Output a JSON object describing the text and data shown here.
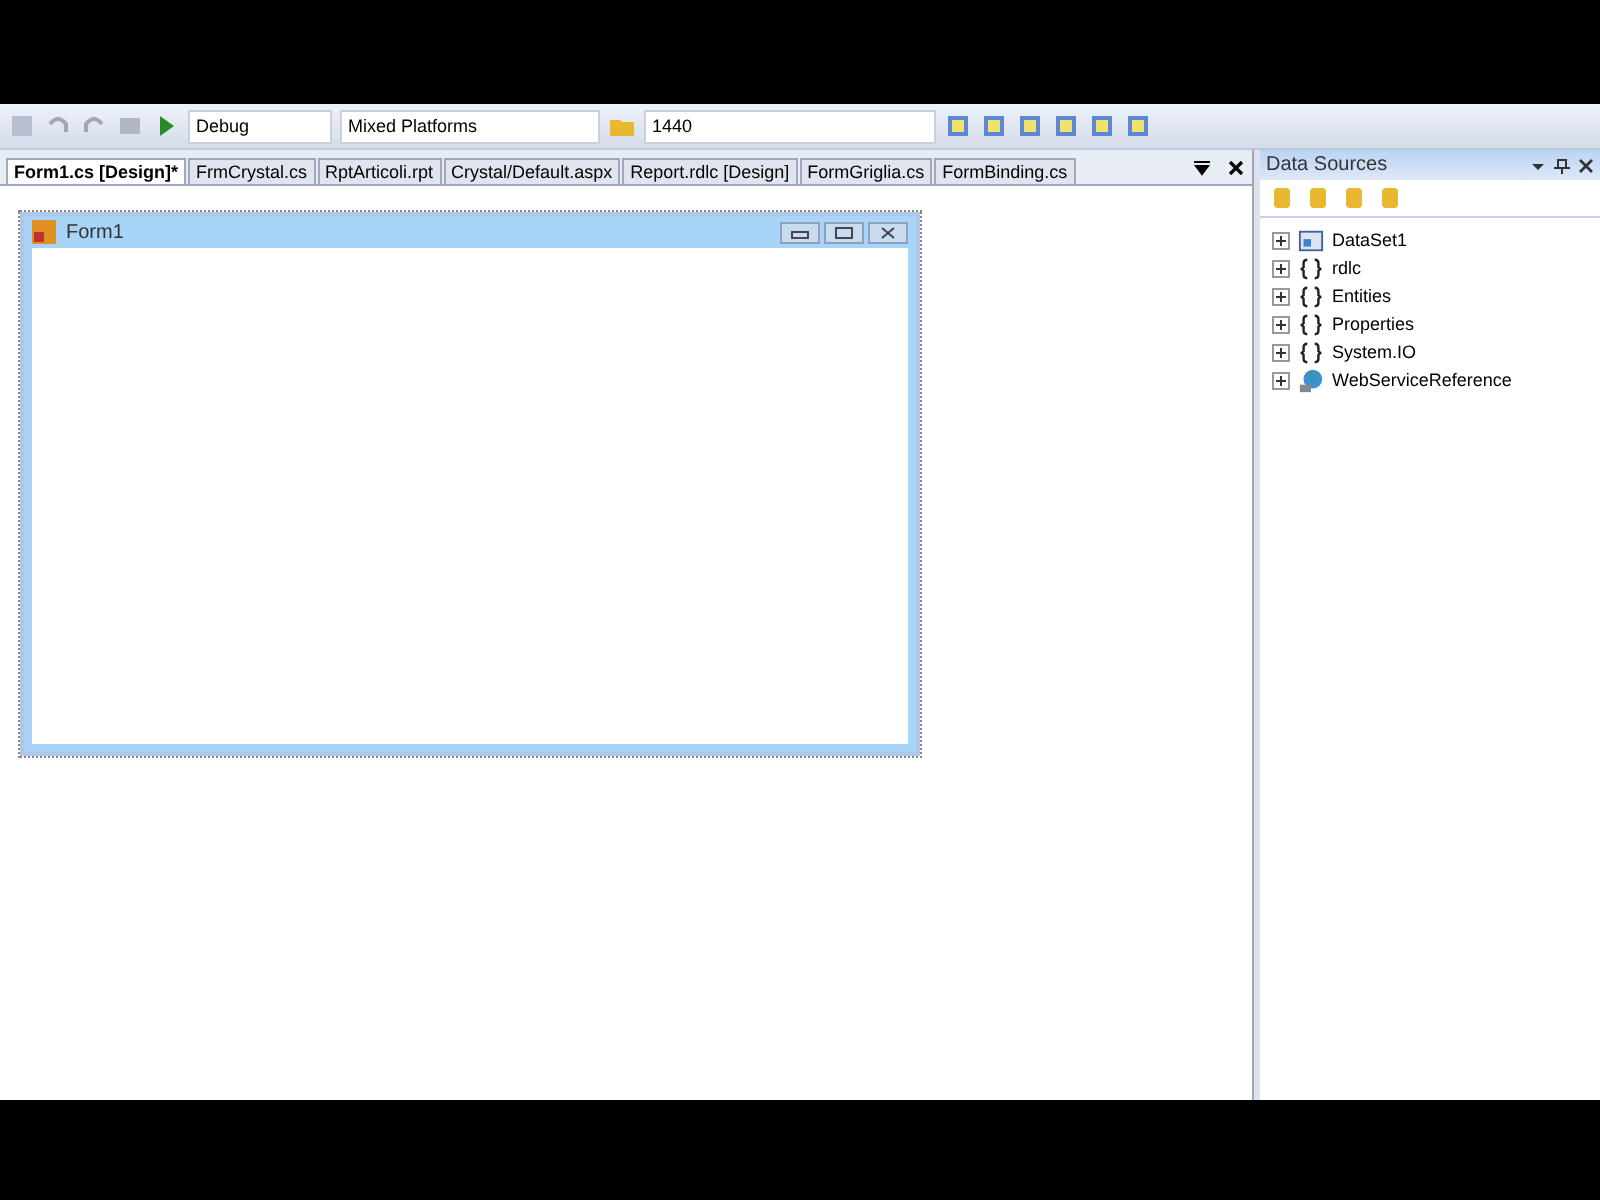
{
  "toolbar": {
    "configuration": "Debug",
    "platform": "Mixed Platforms",
    "find": "1440"
  },
  "tabs": [
    {
      "label": "Form1.cs [Design]*",
      "selected": true
    },
    {
      "label": "FrmCrystal.cs",
      "selected": false
    },
    {
      "label": "RptArticoli.rpt",
      "selected": false
    },
    {
      "label": "Crystal/Default.aspx",
      "selected": false
    },
    {
      "label": "Report.rdlc [Design]",
      "selected": false
    },
    {
      "label": "FormGriglia.cs",
      "selected": false
    },
    {
      "label": "FormBinding.cs",
      "selected": false
    }
  ],
  "form": {
    "title": "Form1"
  },
  "data_sources": {
    "title": "Data Sources",
    "items": [
      {
        "label": "DataSet1",
        "kind": "dataset"
      },
      {
        "label": "rdlc",
        "kind": "namespace"
      },
      {
        "label": "Entities",
        "kind": "namespace"
      },
      {
        "label": "Properties",
        "kind": "namespace"
      },
      {
        "label": "System.IO",
        "kind": "namespace"
      },
      {
        "label": "WebServiceReference",
        "kind": "service"
      }
    ]
  }
}
